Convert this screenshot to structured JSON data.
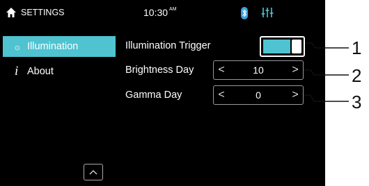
{
  "topbar": {
    "home_icon": "home-icon",
    "title": "SETTINGS",
    "time": "10:30",
    "ampm": "AM",
    "bluetooth_icon": "bluetooth-icon",
    "equalizer_icon": "sliders-icon"
  },
  "sidebar": {
    "items": [
      {
        "icon": "sun-icon",
        "label": "Illumination",
        "active": true
      },
      {
        "icon": "info-icon",
        "icon_text": "i",
        "label": "About",
        "active": false
      }
    ],
    "scroll_up_icon": "chevron-up-icon"
  },
  "settings": {
    "illumination_trigger": {
      "label": "Illumination Trigger",
      "on": true
    },
    "brightness_day": {
      "label": "Brightness Day",
      "value": "10"
    },
    "gamma_day": {
      "label": "Gamma Day",
      "value": "0"
    }
  },
  "stepper_glyphs": {
    "prev": "<",
    "next": ">"
  },
  "callouts": [
    "1",
    "2",
    "3"
  ],
  "colors": {
    "accent": "#4fc3d0",
    "background": "#000000",
    "bluetooth": "#3aa0e0",
    "sliders": "#4fc3d0"
  }
}
